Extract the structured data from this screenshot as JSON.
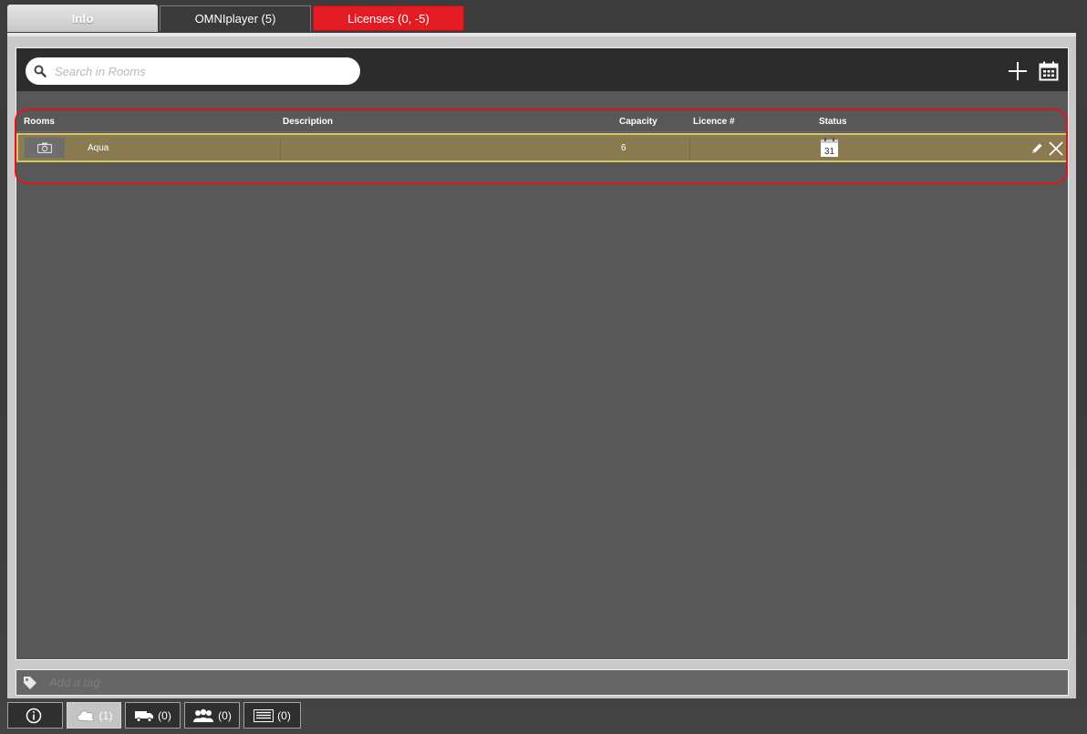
{
  "tabs": {
    "info": "Info",
    "omniplayer": "OMNIplayer (5)",
    "licenses": "Licenses (0, -5)"
  },
  "search": {
    "placeholder": "Search in Rooms"
  },
  "toolbar": {
    "add_icon": "plus-icon",
    "calendar_icon": "calendar-icon"
  },
  "table": {
    "columns": [
      "Rooms",
      "Description",
      "Capacity",
      "Licence #",
      "Status"
    ],
    "rows": [
      {
        "room": "Aqua",
        "description": "",
        "capacity": "6",
        "licence": "",
        "status_icon": "calendar-31-icon",
        "status_day": "31"
      }
    ]
  },
  "tag": {
    "placeholder": "Add a tag"
  },
  "bottom_tabs": [
    {
      "icon": "info-icon",
      "label": ""
    },
    {
      "icon": "cloud-icon",
      "label": "(1)"
    },
    {
      "icon": "truck-icon",
      "label": "(0)"
    },
    {
      "icon": "people-icon",
      "label": "(0)"
    },
    {
      "icon": "list-icon",
      "label": "(0)"
    }
  ],
  "colors": {
    "licenses_tab": "#e31c24",
    "selected_row": "#8a7a4f",
    "selected_row_border": "#d9c26e",
    "highlight_outline": "#e2131b"
  }
}
